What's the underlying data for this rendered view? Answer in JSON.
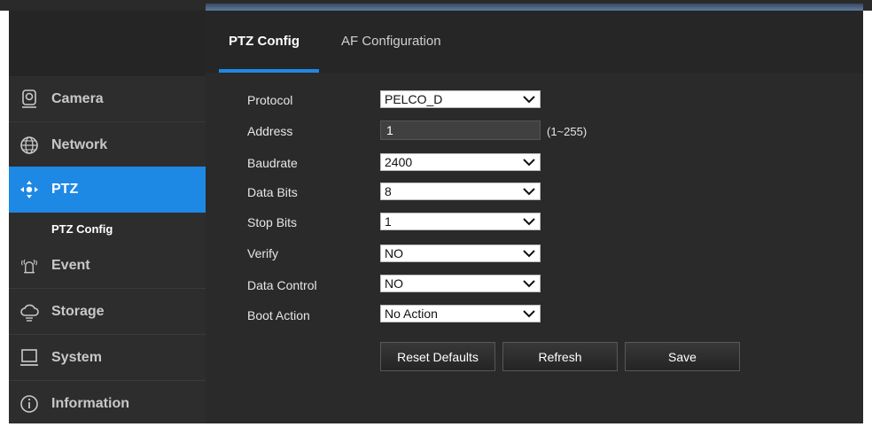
{
  "sidebar": {
    "items": [
      {
        "label": "Camera",
        "icon": "camera-icon"
      },
      {
        "label": "Network",
        "icon": "network-globe-icon"
      },
      {
        "label": "PTZ",
        "icon": "ptz-directional-icon",
        "active": true
      },
      {
        "label": "Event",
        "icon": "event-alarm-icon"
      },
      {
        "label": "Storage",
        "icon": "storage-cloud-icon"
      },
      {
        "label": "System",
        "icon": "system-monitor-icon"
      },
      {
        "label": "Information",
        "icon": "information-icon"
      }
    ],
    "sub_item": "PTZ Config"
  },
  "tabs": [
    {
      "label": "PTZ Config",
      "active": true
    },
    {
      "label": "AF Configuration",
      "active": false
    }
  ],
  "form": {
    "protocol": {
      "label": "Protocol",
      "value": "PELCO_D"
    },
    "address": {
      "label": "Address",
      "value": "1",
      "range": "(1~255)"
    },
    "baudrate": {
      "label": "Baudrate",
      "value": "2400"
    },
    "data_bits": {
      "label": "Data Bits",
      "value": "8"
    },
    "stop_bits": {
      "label": "Stop Bits",
      "value": "1"
    },
    "verify": {
      "label": "Verify",
      "value": "NO"
    },
    "data_control": {
      "label": "Data Control",
      "value": "NO"
    },
    "boot_action": {
      "label": "Boot Action",
      "value": "No Action"
    }
  },
  "buttons": {
    "reset": "Reset Defaults",
    "refresh": "Refresh",
    "save": "Save"
  },
  "colors": {
    "accent": "#1e88e5",
    "sidebar_bg": "#2d2d2d",
    "main_bg": "#2a2a2a"
  }
}
